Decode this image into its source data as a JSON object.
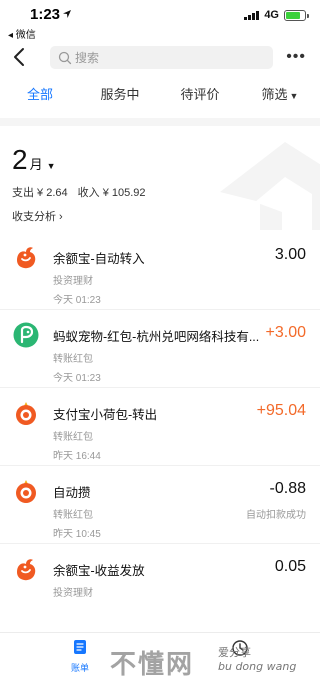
{
  "status_bar": {
    "time": "1:23",
    "back_app": "◂ 微信",
    "network": "4G",
    "battery_level": 0.75
  },
  "nav": {
    "search_placeholder": "搜索",
    "more": "•••"
  },
  "tabs": [
    {
      "label": "全部",
      "active": true
    },
    {
      "label": "服务中",
      "active": false
    },
    {
      "label": "待评价",
      "active": false
    },
    {
      "label": "筛选",
      "active": false
    }
  ],
  "summary": {
    "month_number": "2",
    "month_unit": "月",
    "expense": "支出 ¥ 2.64",
    "income": "收入 ¥ 105.92",
    "analysis": "收支分析 ›"
  },
  "transactions": [
    {
      "title": "余额宝-自动转入",
      "category": "投资理财",
      "time": "今天  01:23",
      "amount": "3.00",
      "status": "",
      "icon": "yuebao-icon",
      "type": "expense"
    },
    {
      "title": "蚂蚁宠物-红包-杭州兑吧网络科技有...",
      "category": "转账红包",
      "time": "今天  01:23",
      "amount": "+3.00",
      "status": "",
      "icon": "ant-pet-icon",
      "type": "income"
    },
    {
      "title": "支付宝小荷包-转出",
      "category": "转账红包",
      "time": "昨天  16:44",
      "amount": "+95.04",
      "status": "",
      "icon": "pouch-icon",
      "type": "income"
    },
    {
      "title": "自动攒",
      "category": "转账红包",
      "time": "昨天  10:45",
      "amount": "-0.88",
      "status": "自动扣款成功",
      "icon": "pouch-icon",
      "type": "expense"
    },
    {
      "title": "余额宝-收益发放",
      "category": "投资理财",
      "time": "",
      "amount": "0.05",
      "status": "",
      "icon": "yuebao-icon",
      "type": "expense"
    }
  ],
  "bottom_tabs": [
    {
      "label": "账单",
      "active": true
    },
    {
      "label": "",
      "active": false
    }
  ],
  "watermark": {
    "main": "不懂网",
    "side": "爱分享",
    "pinyin": "bu dong wang"
  },
  "colors": {
    "accent": "#1677ff",
    "income": "#f36a2a",
    "icon_orange": "#f05a22",
    "icon_green": "#2bb673"
  }
}
